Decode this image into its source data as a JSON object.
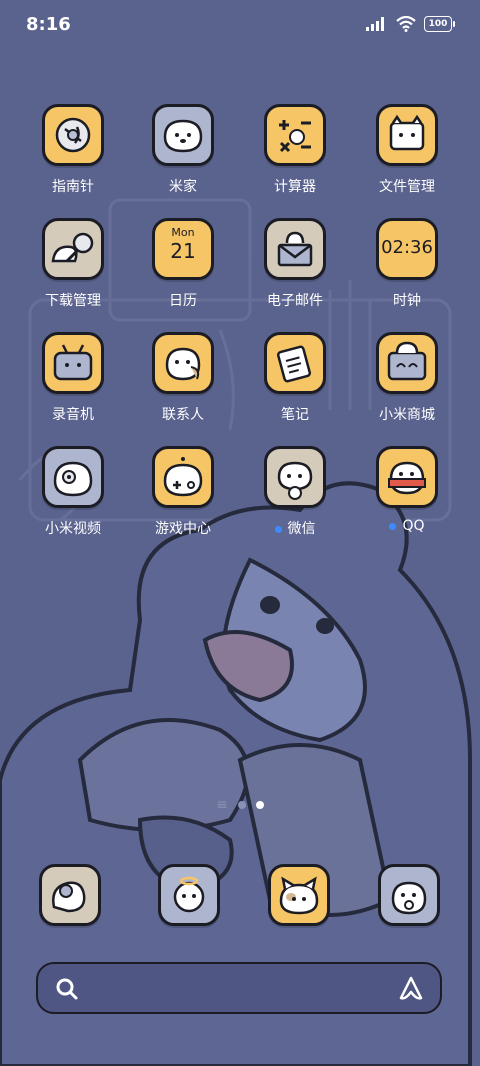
{
  "status_bar": {
    "time": "8:16",
    "battery": "100"
  },
  "apps": [
    {
      "label": "指南针",
      "icon": "compass-icon"
    },
    {
      "label": "米家",
      "icon": "mi-home-icon"
    },
    {
      "label": "计算器",
      "icon": "calculator-icon"
    },
    {
      "label": "文件管理",
      "icon": "file-manager-icon"
    },
    {
      "label": "下载管理",
      "icon": "download-manager-icon"
    },
    {
      "label": "日历",
      "icon": "calendar-icon",
      "weekday": "Mon",
      "day": "21"
    },
    {
      "label": "电子邮件",
      "icon": "email-icon"
    },
    {
      "label": "时钟",
      "icon": "clock-icon",
      "time": "02:36"
    },
    {
      "label": "录音机",
      "icon": "recorder-icon"
    },
    {
      "label": "联系人",
      "icon": "contacts-icon"
    },
    {
      "label": "笔记",
      "icon": "notes-icon"
    },
    {
      "label": "小米商城",
      "icon": "mi-store-icon"
    },
    {
      "label": "小米视频",
      "icon": "mi-video-icon"
    },
    {
      "label": "游戏中心",
      "icon": "game-center-icon"
    },
    {
      "label": "微信",
      "icon": "wechat-icon"
    },
    {
      "label": "QQ",
      "icon": "qq-icon"
    }
  ],
  "dock": [
    {
      "icon": "dock-app-1-icon"
    },
    {
      "icon": "dock-app-2-icon"
    },
    {
      "icon": "dock-app-3-icon"
    },
    {
      "icon": "dock-app-4-icon"
    }
  ],
  "pager": {
    "active_index": 1
  },
  "search_bar": {
    "icon": "search-icon",
    "right_icon": "assistant-icon"
  }
}
